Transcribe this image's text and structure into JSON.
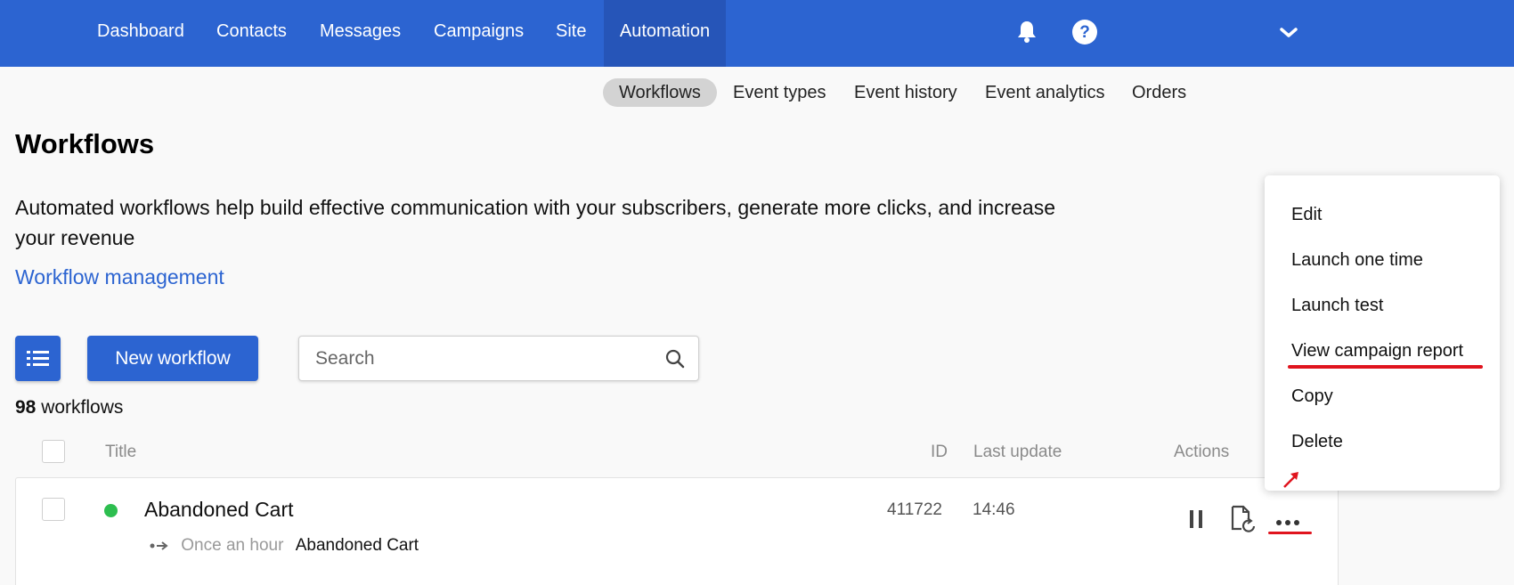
{
  "nav": {
    "items": [
      "Dashboard",
      "Contacts",
      "Messages",
      "Campaigns",
      "Site",
      "Automation"
    ],
    "active": "Automation",
    "accent": "#2c64d1"
  },
  "subtabs": [
    "Workflows",
    "Event types",
    "Event history",
    "Event analytics",
    "Orders"
  ],
  "page": {
    "title": "Workflows",
    "description": "Automated workflows help build effective communication with your subscribers, generate more clicks, and increase your revenue",
    "link": "Workflow management"
  },
  "toolbar": {
    "new_label": "New workflow",
    "search_placeholder": "Search"
  },
  "count": {
    "number": "98",
    "label": "workflows"
  },
  "table": {
    "headers": {
      "title": "Title",
      "id": "ID",
      "last_update": "Last update",
      "actions": "Actions"
    },
    "rows": [
      {
        "title": "Abandoned Cart",
        "trigger": "Once an hour",
        "event": "Abandoned Cart",
        "id": "411722",
        "time": "14:46",
        "status_color": "#2dbe4f"
      }
    ]
  },
  "menu": {
    "items": [
      "Edit",
      "Launch one time",
      "Launch test",
      "View campaign report",
      "Copy",
      "Delete"
    ]
  },
  "icons": [
    "bell-icon",
    "help-icon",
    "chevron-down-icon",
    "list-icon",
    "search-icon",
    "pause-icon",
    "report-refresh-icon",
    "more-icon",
    "arrow-annotation-icon"
  ]
}
